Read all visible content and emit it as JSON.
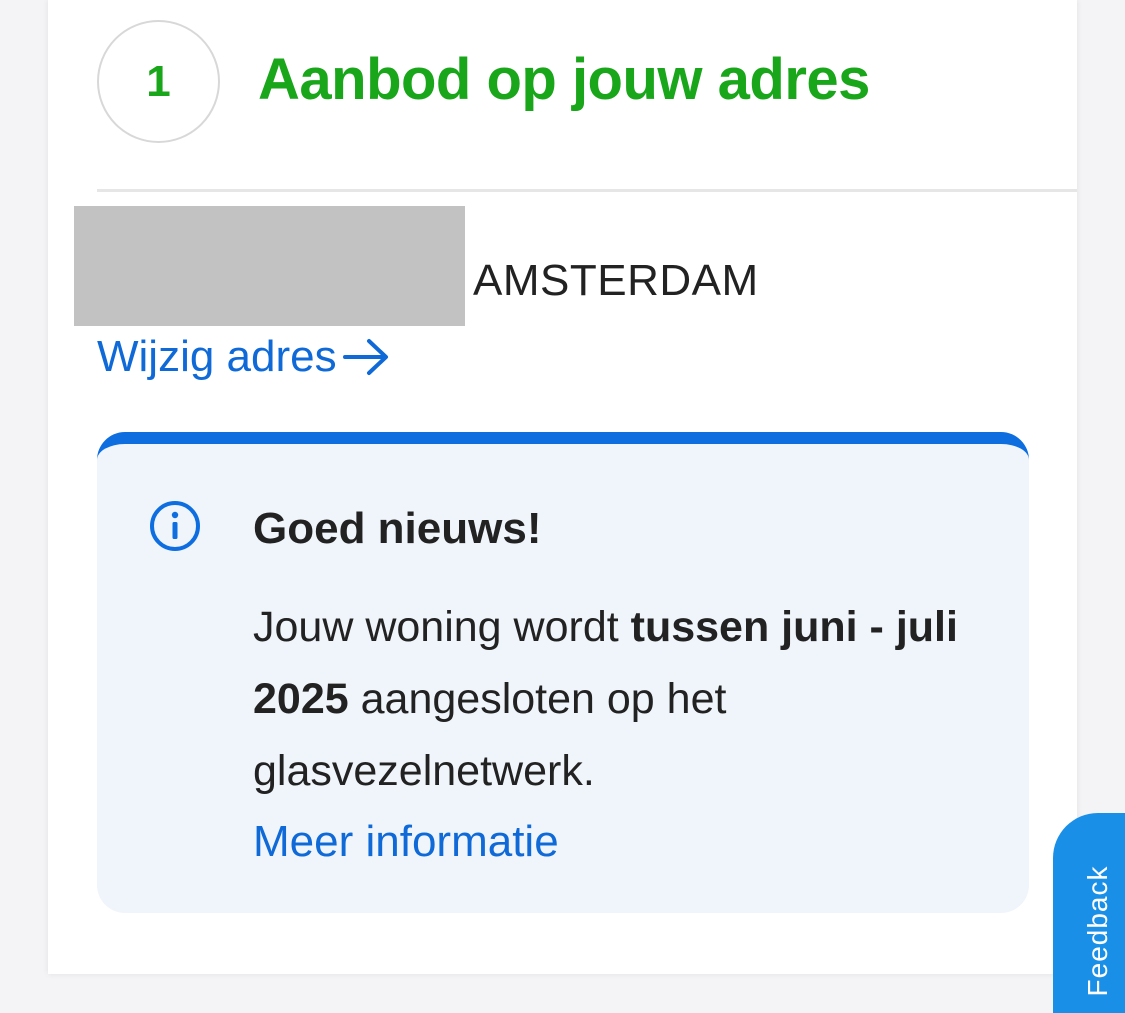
{
  "step": {
    "number": "1",
    "title": "Aanbod op jouw adres"
  },
  "address": {
    "city": "AMSTERDAM",
    "change_label": "Wijzig adres"
  },
  "notice": {
    "icon": "info-icon",
    "title": "Goed nieuws!",
    "body_before": "Jouw woning wordt ",
    "body_bold": "tussen juni - juli 2025",
    "body_after": " aangesloten op het glasvezelnetwerk.",
    "link_label": "Meer informatie"
  },
  "feedback": {
    "label": "Feedback"
  },
  "colors": {
    "brand_green": "#1aa61a",
    "link_blue": "#0f6ad8",
    "notice_bar": "#0e6ee0",
    "notice_bg": "#eff5fb",
    "feedback_bg": "#1a8fe8"
  }
}
